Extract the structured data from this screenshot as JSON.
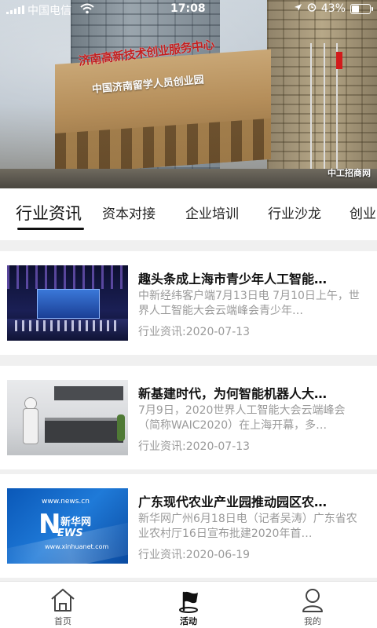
{
  "status_bar": {
    "carrier": "中国电信",
    "time": "17:08",
    "battery": "43%",
    "battery_level": 0.43,
    "icons": [
      "signal-icon",
      "wifi-icon",
      "location-icon",
      "alarm-icon",
      "battery-icon"
    ]
  },
  "banner": {
    "roof_sign": "济南高新技术创业服务中心",
    "building_sign": "中国济南留学人员创业园",
    "watermark": "中工招商网"
  },
  "tabs": {
    "items": [
      {
        "label": "行业资讯",
        "active": true
      },
      {
        "label": "资本对接",
        "active": false
      },
      {
        "label": "企业培训",
        "active": false
      },
      {
        "label": "行业沙龙",
        "active": false
      },
      {
        "label": "创业",
        "active": false
      }
    ]
  },
  "news": {
    "items": [
      {
        "title": "趣头条成上海市青少年人工智能…",
        "summary": "中新经纬客户端7月13日电 7月10日上午，世界人工智能大会云端峰会青少年…",
        "meta": "行业资讯:2020-07-13",
        "thumb": "stage-performance-image"
      },
      {
        "title": "新基建时代，为何智能机器人大…",
        "summary": "7月9日，2020世界人工智能大会云端峰会（简称WAIC2020）在上海开幕，多…",
        "meta": "行业资讯:2020-07-13",
        "thumb": "robot-kitchen-image"
      },
      {
        "title": "广东现代农业产业园推动园区农…",
        "summary": "新华网广州6月18日电（记者吴涛）广东省农业农村厅16日宣布批建2020年首…",
        "meta": "行业资讯:2020-06-19",
        "thumb": "xinhua-logo-image",
        "thumb_text": {
          "url_top": "www.news.cn",
          "logo_cn": "新华网",
          "logo_n": "N",
          "logo_ews": "EWS",
          "url_bottom": "www.xinhuanet.com"
        }
      }
    ]
  },
  "bottom_nav": {
    "items": [
      {
        "label": "首页",
        "icon": "home-icon",
        "active": false
      },
      {
        "label": "活动",
        "icon": "flag-icon",
        "active": true
      },
      {
        "label": "我的",
        "icon": "user-icon",
        "active": false
      }
    ]
  },
  "colors": {
    "text_primary": "#111111",
    "text_secondary": "#9a9a9a",
    "background": "#f0f0f0",
    "card": "#ffffff",
    "sign_red": "#c21f1f"
  }
}
